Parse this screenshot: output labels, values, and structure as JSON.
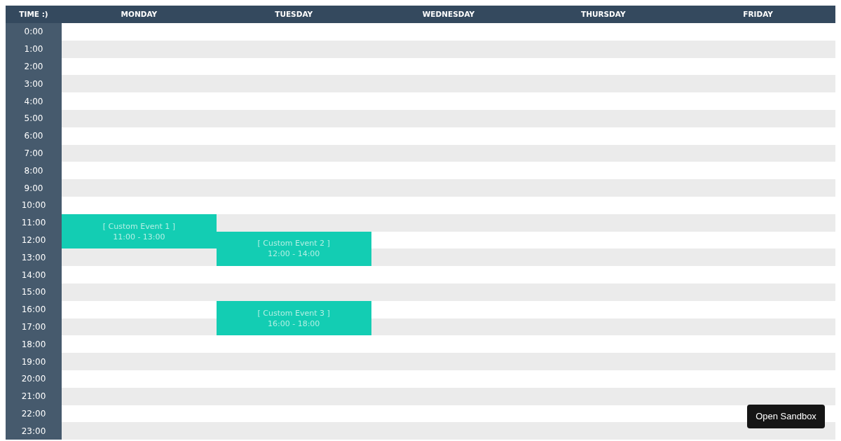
{
  "header": {
    "time_label": "TIME :)"
  },
  "days": [
    {
      "label": "MONDAY",
      "events": [
        {
          "title": "[ Custom Event 1 ]",
          "time": "11:00 - 13:00"
        }
      ]
    },
    {
      "label": "TUESDAY",
      "events": [
        {
          "title": "[ Custom Event 2 ]",
          "time": "12:00 - 14:00"
        },
        {
          "title": "[ Custom Event 3 ]",
          "time": "16:00 - 18:00"
        }
      ]
    },
    {
      "label": "WEDNESDAY"
    },
    {
      "label": "THURSDAY"
    },
    {
      "label": "FRIDAY"
    }
  ],
  "hours": [
    "0:00",
    "1:00",
    "2:00",
    "3:00",
    "4:00",
    "5:00",
    "6:00",
    "7:00",
    "8:00",
    "9:00",
    "10:00",
    "11:00",
    "12:00",
    "13:00",
    "14:00",
    "15:00",
    "16:00",
    "17:00",
    "18:00",
    "19:00",
    "20:00",
    "21:00",
    "22:00",
    "23:00"
  ],
  "sandbox_button": "Open Sandbox"
}
